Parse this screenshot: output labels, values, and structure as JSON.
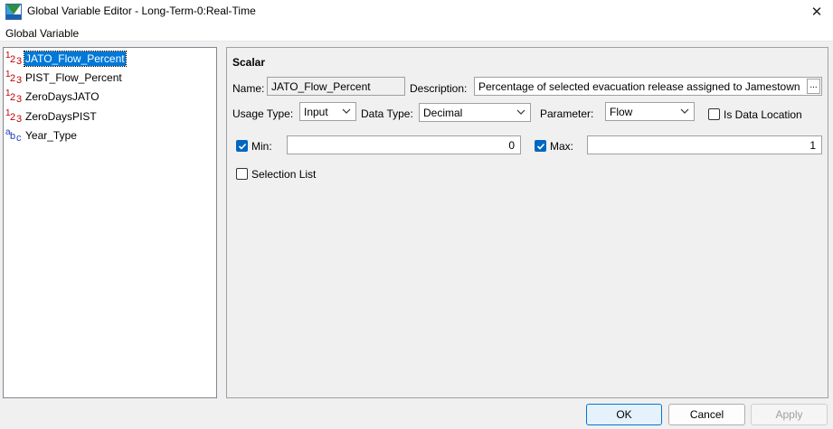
{
  "window": {
    "title": "Global Variable Editor - Long-Term-0:Real-Time",
    "close_glyph": "✕"
  },
  "menu": {
    "items": [
      "Global Variable"
    ]
  },
  "tree": {
    "items": [
      {
        "label": "JATO_Flow_Percent",
        "type": "numeric",
        "icon_a": "1",
        "icon_b": "2",
        "icon_c": "3",
        "selected": true
      },
      {
        "label": "PIST_Flow_Percent",
        "type": "numeric",
        "icon_a": "1",
        "icon_b": "2",
        "icon_c": "3",
        "selected": false
      },
      {
        "label": "ZeroDaysJATO",
        "type": "numeric",
        "icon_a": "1",
        "icon_b": "2",
        "icon_c": "3",
        "selected": false
      },
      {
        "label": "ZeroDaysPIST",
        "type": "numeric",
        "icon_a": "1",
        "icon_b": "2",
        "icon_c": "3",
        "selected": false
      },
      {
        "label": "Year_Type",
        "type": "string",
        "icon_a": "a",
        "icon_b": "b",
        "icon_c": "c",
        "selected": false
      }
    ]
  },
  "scalar": {
    "section_title": "Scalar",
    "name_label": "Name:",
    "name_value": "JATO_Flow_Percent",
    "description_label": "Description:",
    "description_value": "Percentage of selected evacuation release assigned to Jamestown",
    "description_button": "...",
    "usage_type_label": "Usage Type:",
    "usage_type_value": "Input",
    "data_type_label": "Data Type:",
    "data_type_value": "Decimal",
    "parameter_label": "Parameter:",
    "parameter_value": "Flow",
    "is_data_location_label": "Is Data Location",
    "is_data_location_checked": false,
    "min_label": "Min:",
    "min_checked": true,
    "min_value": "0",
    "max_label": "Max:",
    "max_checked": true,
    "max_value": "1",
    "selection_list_label": "Selection List",
    "selection_list_checked": false
  },
  "footer": {
    "ok_label": "OK",
    "cancel_label": "Cancel",
    "apply_label": "Apply"
  },
  "colors": {
    "selection": "#0078d7",
    "checkbox_checked": "#0067c0",
    "numeric_icon": "#c00000",
    "string_icon": "#1f3fbf"
  }
}
